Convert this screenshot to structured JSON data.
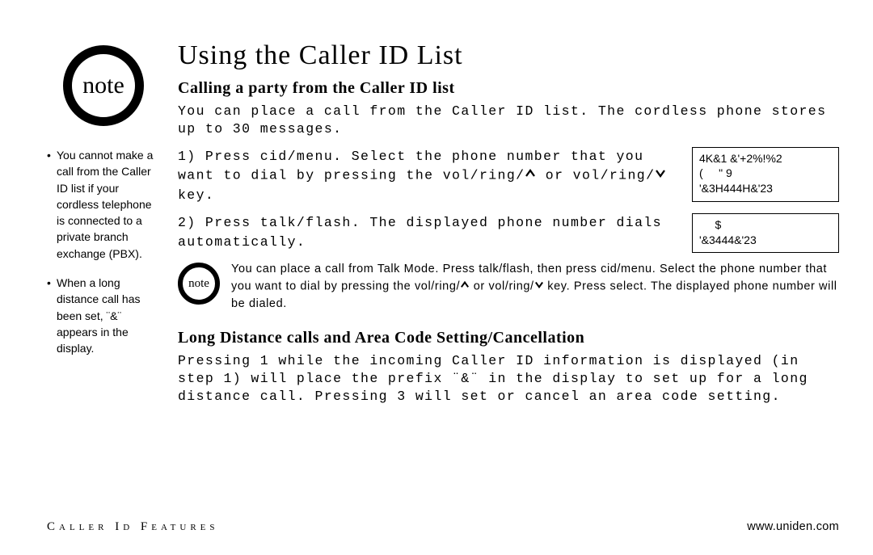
{
  "sidebar": {
    "note_label": "note",
    "bullets": [
      "You cannot make a call from the Caller ID list if your cordless telephone is connected to a private branch exchange (PBX).",
      "When a long distance call has been set, ¨&¨ appears in the display."
    ]
  },
  "main": {
    "title": "Using the Caller ID List",
    "section1_heading": "Calling a party from the Caller ID list",
    "section1_intro": "You can place a call from the Caller ID list. The cordless phone stores up to 30 messages.",
    "step1_text_a": "1) Press cid/menu. Select the phone number that you want to dial by pressing the vol/ring/",
    "step1_text_b": " or vol/ring/",
    "step1_text_c": " key.",
    "step2_text": "2) Press talk/flash. The displayed phone number dials automatically.",
    "code1": "4K&1 &'+2%!%2\n(     \" 9\n'&3H444H&'23",
    "code2": "     $\n'&3444&'23",
    "inline_note_label": "note",
    "inline_note_text_a": "You can place a call from Talk Mode. Press talk/flash, then press cid/menu. Select the phone number that you want to dial by pressing the vol/ring/",
    "inline_note_text_b": " or vol/ring/",
    "inline_note_text_c": " key. Press select. The displayed phone number will be dialed.",
    "section2_heading": "Long Distance calls and Area Code Setting/Cancellation",
    "section2_body": "Pressing 1 while the incoming Caller ID information is displayed (in step 1) will place the prefix ¨&¨ in the display to set up for a long distance call. Pressing 3 will set or cancel an area code setting."
  },
  "footer": {
    "left": "Caller Id Features",
    "right": "www.uniden.com"
  }
}
